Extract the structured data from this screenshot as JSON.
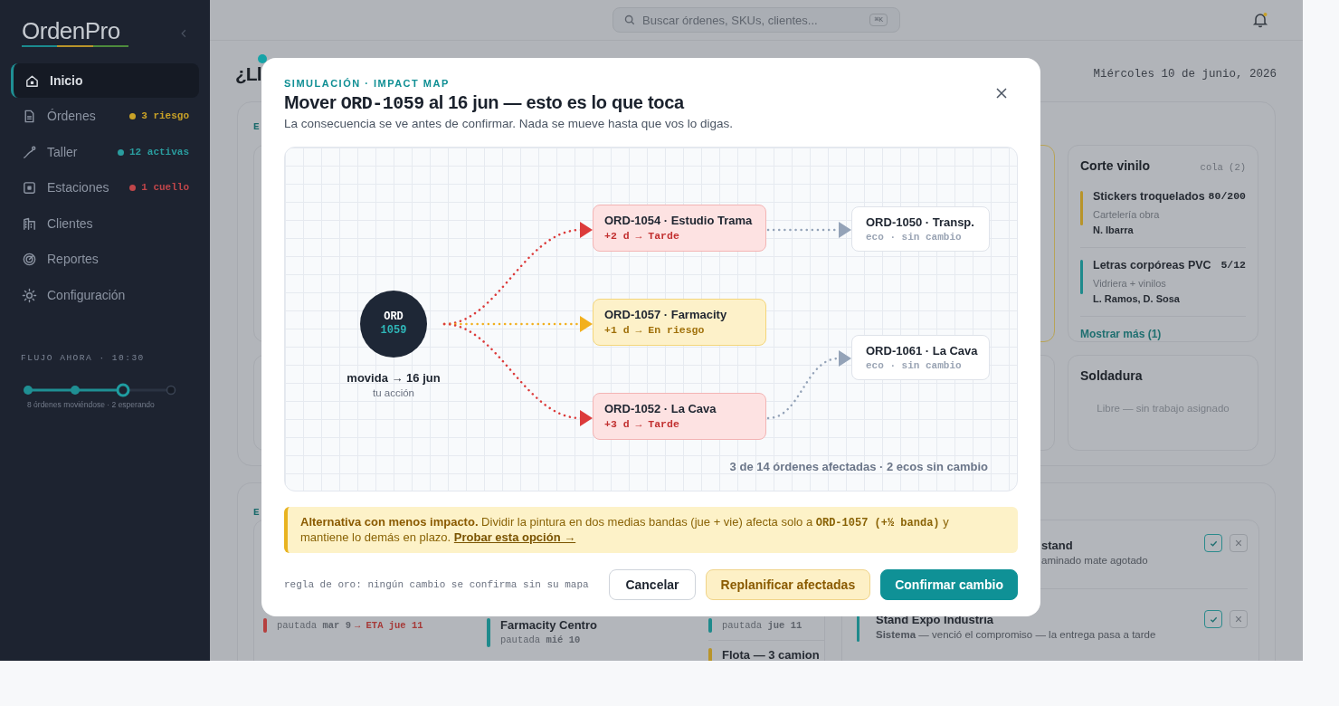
{
  "sidebar": {
    "logo": "OrdenPro",
    "items": [
      {
        "label": "Inicio",
        "selected": true
      },
      {
        "label": "Órdenes",
        "selected": false,
        "badge": "3 riesgo",
        "color": "#c9a227"
      },
      {
        "label": "Taller",
        "selected": false,
        "badge": "12 activas",
        "color": "#2a9d9f"
      },
      {
        "label": "Estaciones",
        "selected": false,
        "badge": "1 cuello",
        "color": "#c0464a"
      },
      {
        "label": "Clientes",
        "selected": false
      },
      {
        "label": "Reportes",
        "selected": false
      },
      {
        "label": "Configuración",
        "selected": false
      }
    ],
    "flow": {
      "label": "FLUJO AHORA · 10:30",
      "steps": [
        {
          "kind": "done"
        },
        {
          "kind": "done"
        },
        {
          "kind": "current"
        },
        {
          "kind": "pending"
        }
      ],
      "caption": "8 órdenes moviéndose · 2 esperando"
    }
  },
  "topbar": {
    "search": {
      "placeholder": "Buscar órdenes, SKUs, clientes...",
      "shortcut": "⌘K"
    },
    "notifications": {
      "unread": true
    }
  },
  "page": {
    "heading": "¿Ll",
    "date": "Miércoles 10 de junio, 2026"
  },
  "stations": {
    "label": "E",
    "cards": [
      {
        "title": "Corte vinilo",
        "queue": "cola (2)",
        "jobs": [
          {
            "name": "Stickers troquelados",
            "qty": "80/200",
            "client": "Cartelería obra",
            "people": "N. Ibarra",
            "color": "#b8942a"
          },
          {
            "name": "Letras corpóreas PVC",
            "qty": "5/12",
            "client": "Vidriera + vinilos",
            "people": "L. Ramos, D. Sosa",
            "color": "#1f8a8c"
          }
        ],
        "more": "Mostrar más (1)"
      },
      {
        "title": "Soldadura",
        "empty": "Libre — sin trabajo asignado"
      }
    ]
  },
  "deliveries": {
    "label": "E",
    "columns": [
      [
        {
          "meta": "pautada **mar 9**",
          "late": "→ ETA jue 11",
          "color": "#b5403f"
        }
      ],
      [
        {
          "title": "Farmacity Centro",
          "meta": "pautada **mié 10**",
          "color": "#1f8a8c"
        }
      ],
      [
        {
          "meta": "pautada **jue 11**",
          "color": "#1f8a8c"
        },
        {
          "title": "Flota — 3 camion",
          "color": "#b8942a"
        }
      ]
    ],
    "alerts": [
      {
        "title": "stand",
        "detail": "aminado mate agotado"
      },
      {
        "title": "Stand Expo Industria",
        "detail": "**Sistema** — venció el compromiso — la entrega pasa a tarde",
        "color": "#1f8a8c"
      }
    ]
  },
  "modal": {
    "eyebrow": "SIMULACIÓN · IMPACT MAP",
    "title": [
      {
        "text": "Mover "
      },
      {
        "text": "ORD-1059",
        "kind": "code"
      },
      {
        "text": " al 16 jun — esto es lo que toca"
      }
    ],
    "subtitle": "La consecuencia se ve antes de confirmar. Nada se mueve hasta que vos lo digas.",
    "map": {
      "origin": {
        "prefix": "ORD",
        "number": "1059",
        "caption": "movida → 16 jun",
        "note": "tu acción"
      },
      "impacts": [
        {
          "title": "ORD-1054 · Estudio Trama",
          "effect": "+2 d → Tarde",
          "kind": "late",
          "echo": {
            "title": "ORD-1050 · Transp.",
            "note": "eco · sin cambio"
          }
        },
        {
          "title": "ORD-1057 · Farmacity",
          "effect": "+1 d → En riesgo",
          "kind": "risk"
        },
        {
          "title": "ORD-1052 · La Cava",
          "effect": "+3 d → Tarde",
          "kind": "late",
          "echo": {
            "title": "ORD-1061 · La Cava",
            "note": "eco · sin cambio"
          }
        }
      ],
      "summary": "3 de 14 órdenes afectadas · 2 ecos sin cambio"
    },
    "hint": {
      "lead": "Alternativa con menos impacto.",
      "before": "Dividir la pintura en dos medias bandas (jue + vie) afecta solo a",
      "code": "ORD-1057 (+½ banda)",
      "after": "y mantiene lo demás en plazo.",
      "link": "Probar esta opción →"
    },
    "rule": "regla de oro: ningún cambio se confirma sin su mapa",
    "buttons": [
      {
        "label": "Cancelar",
        "kind": "secondary"
      },
      {
        "label": "Replanificar afectadas",
        "kind": "warning"
      },
      {
        "label": "Confirmar cambio",
        "kind": "primary"
      }
    ]
  }
}
